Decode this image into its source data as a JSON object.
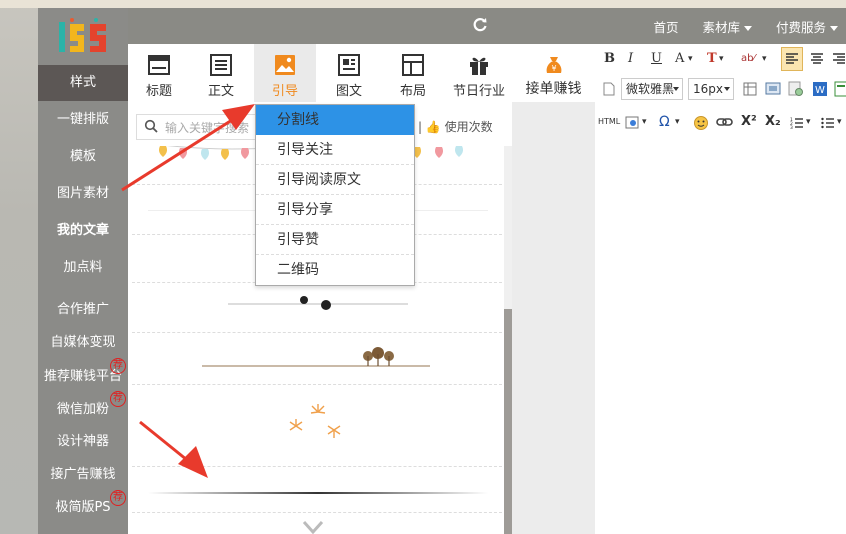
{
  "topbar": {
    "nav": [
      "首页",
      "素材库",
      "付费服务"
    ],
    "refresh_icon": "refresh-icon"
  },
  "sidebar": {
    "items": [
      {
        "label": "样式",
        "active": true
      },
      {
        "label": "一键排版"
      },
      {
        "label": "模板"
      },
      {
        "label": "图片素材"
      },
      {
        "label": "我的文章",
        "bold": true
      },
      {
        "label": "加点料"
      },
      {
        "label": "合作推广"
      },
      {
        "label": "自媒体变现"
      },
      {
        "label": "推荐赚钱平台",
        "badge": "荐"
      },
      {
        "label": "微信加粉",
        "badge": "荐"
      },
      {
        "label": "设计神器"
      },
      {
        "label": "接广告赚钱"
      },
      {
        "label": "极简版PS",
        "badge": "荐"
      }
    ]
  },
  "tabs": [
    {
      "label": "标题",
      "icon": "title-icon"
    },
    {
      "label": "正文",
      "icon": "text-icon"
    },
    {
      "label": "引导",
      "icon": "image-icon",
      "active": true
    },
    {
      "label": "图文",
      "icon": "image-text-icon"
    },
    {
      "label": "布局",
      "icon": "layout-icon"
    },
    {
      "label": "节日行业",
      "icon": "gift-icon"
    }
  ],
  "earn": {
    "label": "接单赚钱",
    "icon": "money-bag-icon"
  },
  "search": {
    "placeholder": "输入关键字搜索",
    "usecount": "使用次数"
  },
  "dropdown": {
    "items": [
      "分割线",
      "引导关注",
      "引导阅读原文",
      "引导分享",
      "引导赞",
      "二维码"
    ],
    "selected": "分割线"
  },
  "editor": {
    "font": "微软雅黑",
    "size": "16px",
    "row1": [
      "B",
      "I",
      "U",
      "A",
      "T"
    ],
    "row3": [
      "HTML",
      "Ω"
    ]
  },
  "colors": {
    "accent": "#f08a1e",
    "selected": "#2d92e6",
    "sidebar_bg": "#8b8b88",
    "sidebar_active": "#5c5755",
    "arrow": "#e83a2c",
    "badge": "#e02020"
  }
}
